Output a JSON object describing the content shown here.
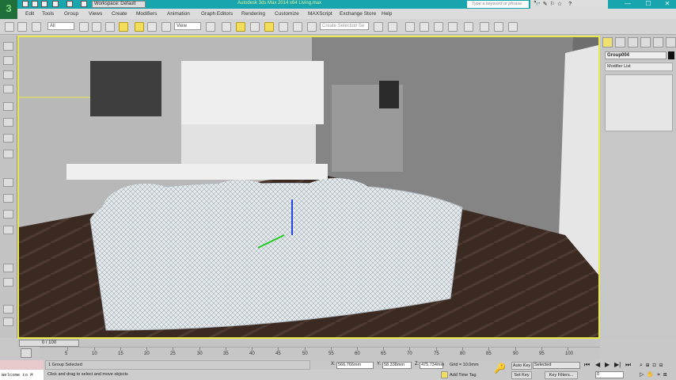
{
  "titlebar": {
    "workspace": "Workspace: Default",
    "title": "Autodesk 3ds Max 2014 x64    Living.max",
    "search_placeholder": "Type a keyword or phrase",
    "help_icons": "🔭✎⚐☆ ?",
    "min": "—",
    "max": "☐",
    "close": "✕"
  },
  "menu": [
    "Edit",
    "Tools",
    "Group",
    "Views",
    "Create",
    "Modifiers",
    "Animation",
    "Graph Editors",
    "Rendering",
    "Customize",
    "MAXScript",
    "Exchange Store",
    "Help"
  ],
  "toolbar": {
    "filter": "All",
    "ref_coord": "View",
    "selection_set": "Create Selection Se"
  },
  "panel": {
    "object_name": "Group004",
    "modifier_list": "Modifier List"
  },
  "timeline": {
    "frame": "0 / 100",
    "ticks": [
      "5",
      "10",
      "15",
      "20",
      "25",
      "30",
      "35",
      "40",
      "45",
      "50",
      "55",
      "60",
      "65",
      "70",
      "75",
      "80",
      "85",
      "90",
      "95",
      "100"
    ]
  },
  "status": {
    "selection": "1 Group Selected",
    "prompt": "Click and drag to select and move objects",
    "welcome": "Welcome to M",
    "x": "566.766mm",
    "y": "58.338mm",
    "z": "475.734mm",
    "grid": "Grid = 10.0mm",
    "add_time_tag": "Add Time Tag",
    "auto_key": "Auto Key",
    "set_key": "Set Key",
    "key_mode": "Selected",
    "key_filters": "Key Filters...",
    "current_frame": "0"
  },
  "colors": {
    "accent": "#19a5ad",
    "viewport_border": "#e8e84a"
  }
}
